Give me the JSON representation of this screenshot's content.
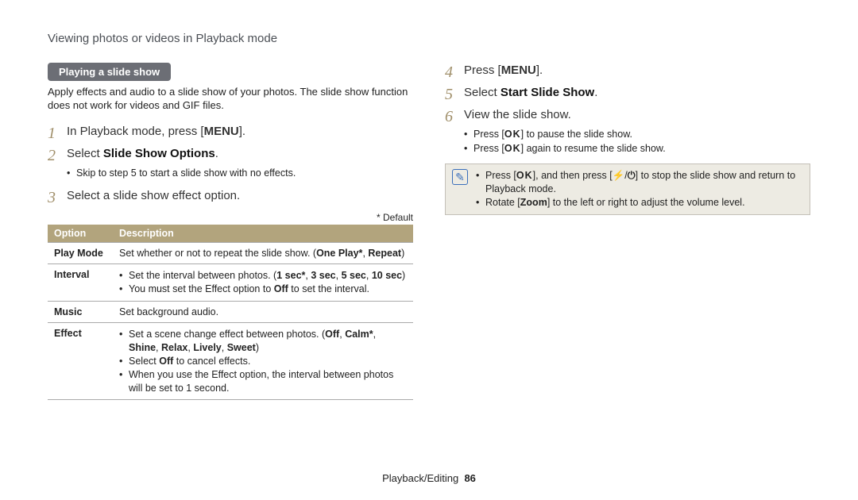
{
  "header": "Viewing photos or videos in Playback mode",
  "footer": {
    "section": "Playback/Editing",
    "page": "86"
  },
  "left": {
    "subhead": "Playing a slide show",
    "intro": "Apply effects and audio to a slide show of your photos. The slide show function does not work for videos and GIF files.",
    "step1_pre": "In Playback mode, press [",
    "step1_icon": "MENU",
    "step1_post": "].",
    "step2_pre": "Select ",
    "step2_bold": "Slide Show Options",
    "step2_post": ".",
    "step2_sub": "Skip to step 5 to start a slide show with no effects.",
    "step3": "Select a slide show effect option.",
    "default_note": "* Default",
    "table": {
      "h1": "Option",
      "h2": "Description",
      "r1": {
        "opt": "Play Mode",
        "desc_pre": "Set whether or not to repeat the slide show. (",
        "desc_bold": "One Play*",
        "desc_mid": ", ",
        "desc_bold2": "Repeat",
        "desc_post": ")"
      },
      "r2": {
        "opt": "Interval",
        "b1_pre": "Set the interval between photos. (",
        "b1_bold": "1 sec*",
        "b1_mid1": ", ",
        "b1_bold2": "3 sec",
        "b1_mid2": ", ",
        "b1_bold3": "5 sec",
        "b1_mid3": ", ",
        "b1_bold4": "10 sec",
        "b1_post": ")",
        "b2_pre": "You must set the Effect option to ",
        "b2_bold": "Off",
        "b2_post": " to set the interval."
      },
      "r3": {
        "opt": "Music",
        "desc": "Set background audio."
      },
      "r4": {
        "opt": "Effect",
        "b1_pre": "Set a scene change effect between photos. (",
        "b1_bold1": "Off",
        "b1_s1": ", ",
        "b1_bold2": "Calm*",
        "b1_s2": ", ",
        "b1_bold3": "Shine",
        "b1_s3": ", ",
        "b1_bold4": "Relax",
        "b1_s4": ", ",
        "b1_bold5": "Lively",
        "b1_s5": ", ",
        "b1_bold6": "Sweet",
        "b1_post": ")",
        "b2_pre": "Select ",
        "b2_bold": "Off",
        "b2_post": " to cancel effects.",
        "b3": "When you use the Effect option, the interval between photos will be set to 1 second."
      }
    }
  },
  "right": {
    "step4_pre": "Press [",
    "step4_icon": "MENU",
    "step4_post": "].",
    "step5_pre": "Select ",
    "step5_bold": "Start Slide Show",
    "step5_post": ".",
    "step6": "View the slide show.",
    "sub1_pre": "Press [",
    "sub1_icon": "OK",
    "sub1_post": "] to pause the slide show.",
    "sub2_pre": "Press [",
    "sub2_icon": "OK",
    "sub2_post": "] again to resume the slide show.",
    "note": {
      "b1_pre": "Press [",
      "b1_icon1": "OK",
      "b1_mid1": "], and then press [",
      "b1_icon2": "⚡",
      "b1_slash": "/",
      "b1_icon3": "⏻",
      "b1_post": "] to stop the slide show and return to Playback mode.",
      "b2_pre": "Rotate [",
      "b2_bold": "Zoom",
      "b2_post": "] to the left or right to adjust the volume level."
    }
  }
}
